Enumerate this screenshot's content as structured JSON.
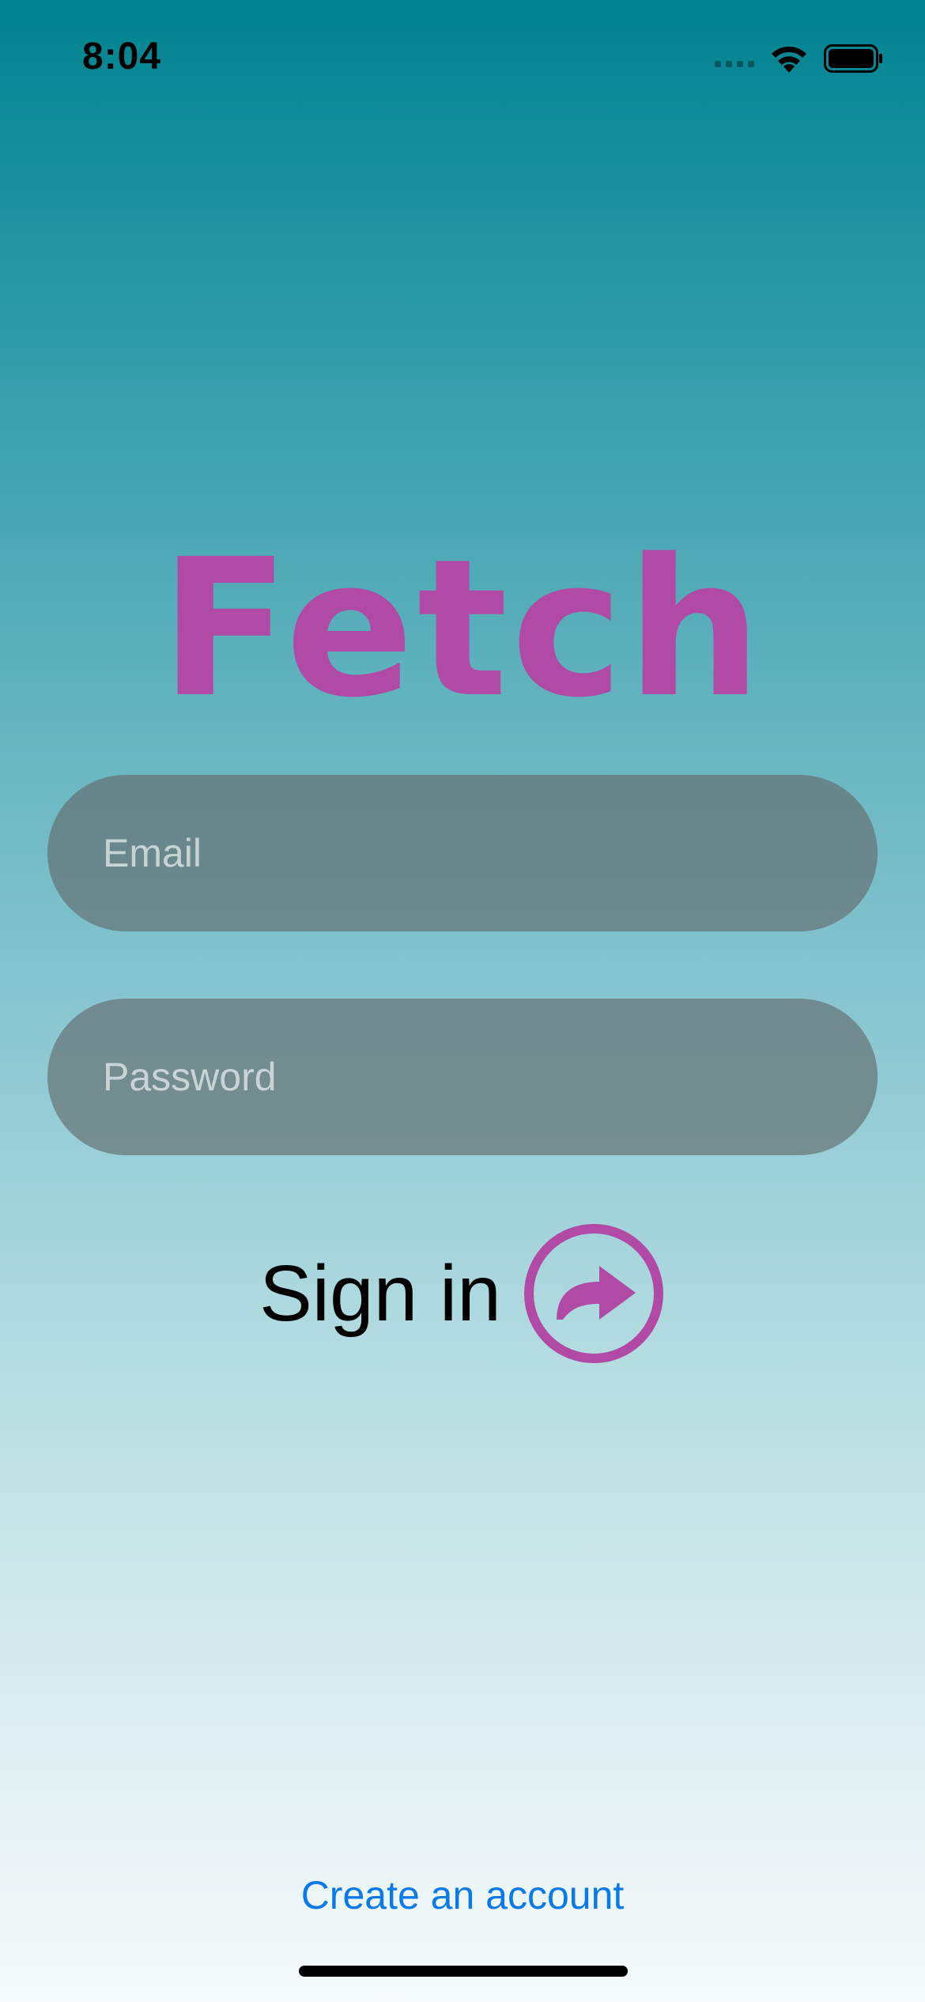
{
  "status_bar": {
    "time": "8:04",
    "icons": [
      "cellular-signal-icon",
      "wifi-icon",
      "battery-icon"
    ]
  },
  "app": {
    "title": "Fetch",
    "brand_color": "#b04aa5"
  },
  "form": {
    "email": {
      "placeholder": "Email",
      "value": ""
    },
    "password": {
      "placeholder": "Password",
      "value": ""
    },
    "sign_in_label": "Sign in",
    "sign_in_icon": "arrow-forward-circle-icon"
  },
  "footer": {
    "create_account_label": "Create an account",
    "link_color": "#0a7aeb"
  }
}
